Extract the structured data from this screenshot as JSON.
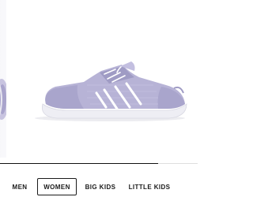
{
  "carousel": {
    "progress": 0.8
  },
  "category_tabs": [
    {
      "label": "MEN",
      "active": false
    },
    {
      "label": "WOMEN",
      "active": true
    },
    {
      "label": "BIG KIDS",
      "active": false
    },
    {
      "label": "LITTLE KIDS",
      "active": false
    }
  ],
  "colors": {
    "shoe_upper": "#b7b3d6",
    "shoe_sole": "#eeeef4",
    "accent_text": "#1a1a1a"
  }
}
